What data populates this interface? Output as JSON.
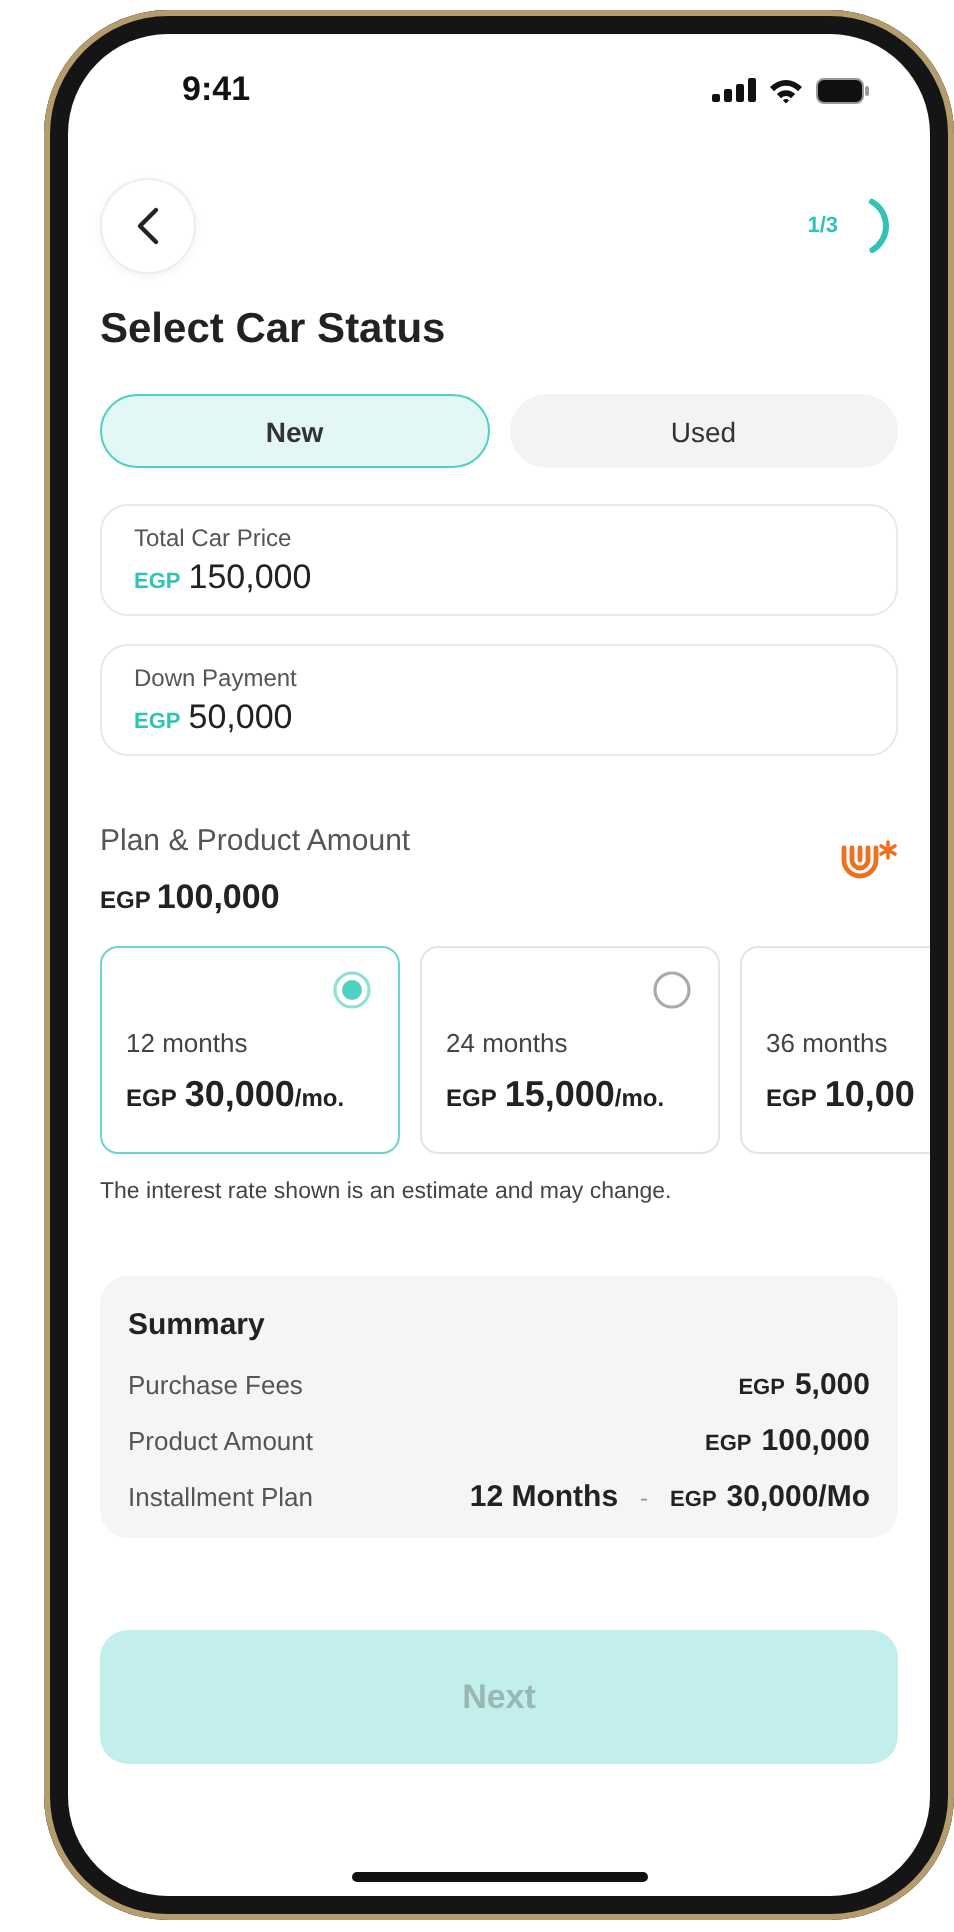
{
  "status_bar": {
    "time": "9:41"
  },
  "header": {
    "step": {
      "label": "1/3",
      "level": 0.33
    }
  },
  "title": "Select Car Status",
  "car_status": [
    {
      "label": "New",
      "selected": true
    },
    {
      "label": "Used",
      "selected": false
    }
  ],
  "fields": [
    {
      "label": "Total Car Price",
      "currency": "EGP",
      "value": "150,000"
    },
    {
      "label": "Down Payment",
      "currency": "EGP",
      "value": "50,000"
    }
  ],
  "plan": {
    "label": "Plan & Product Amount",
    "currency": "EGP",
    "amount": "100,000"
  },
  "plans": [
    {
      "duration": "12 months",
      "currency": "EGP",
      "amount": "30,000",
      "unit": "/mo.",
      "selected": true
    },
    {
      "duration": "24 months",
      "currency": "EGP",
      "amount": "15,000",
      "unit": "/mo.",
      "selected": false
    },
    {
      "duration": "36 months",
      "currency": "EGP",
      "amount": "10,00",
      "selected": false
    }
  ],
  "note": "The interest rate shown is an estimate and may change.",
  "summary": {
    "title": "Summary",
    "rows": [
      {
        "label": "Purchase Fees",
        "currency": "EGP",
        "value": "5,000"
      },
      {
        "label": "Product Amount",
        "currency": "EGP",
        "value": "100,000"
      },
      {
        "label": "Installment Plan",
        "prefix": "12 Months",
        "separator": "-",
        "currency": "EGP",
        "value": "30,000/Mo"
      }
    ]
  },
  "next_button": {
    "label": "Next",
    "disabled": true
  }
}
